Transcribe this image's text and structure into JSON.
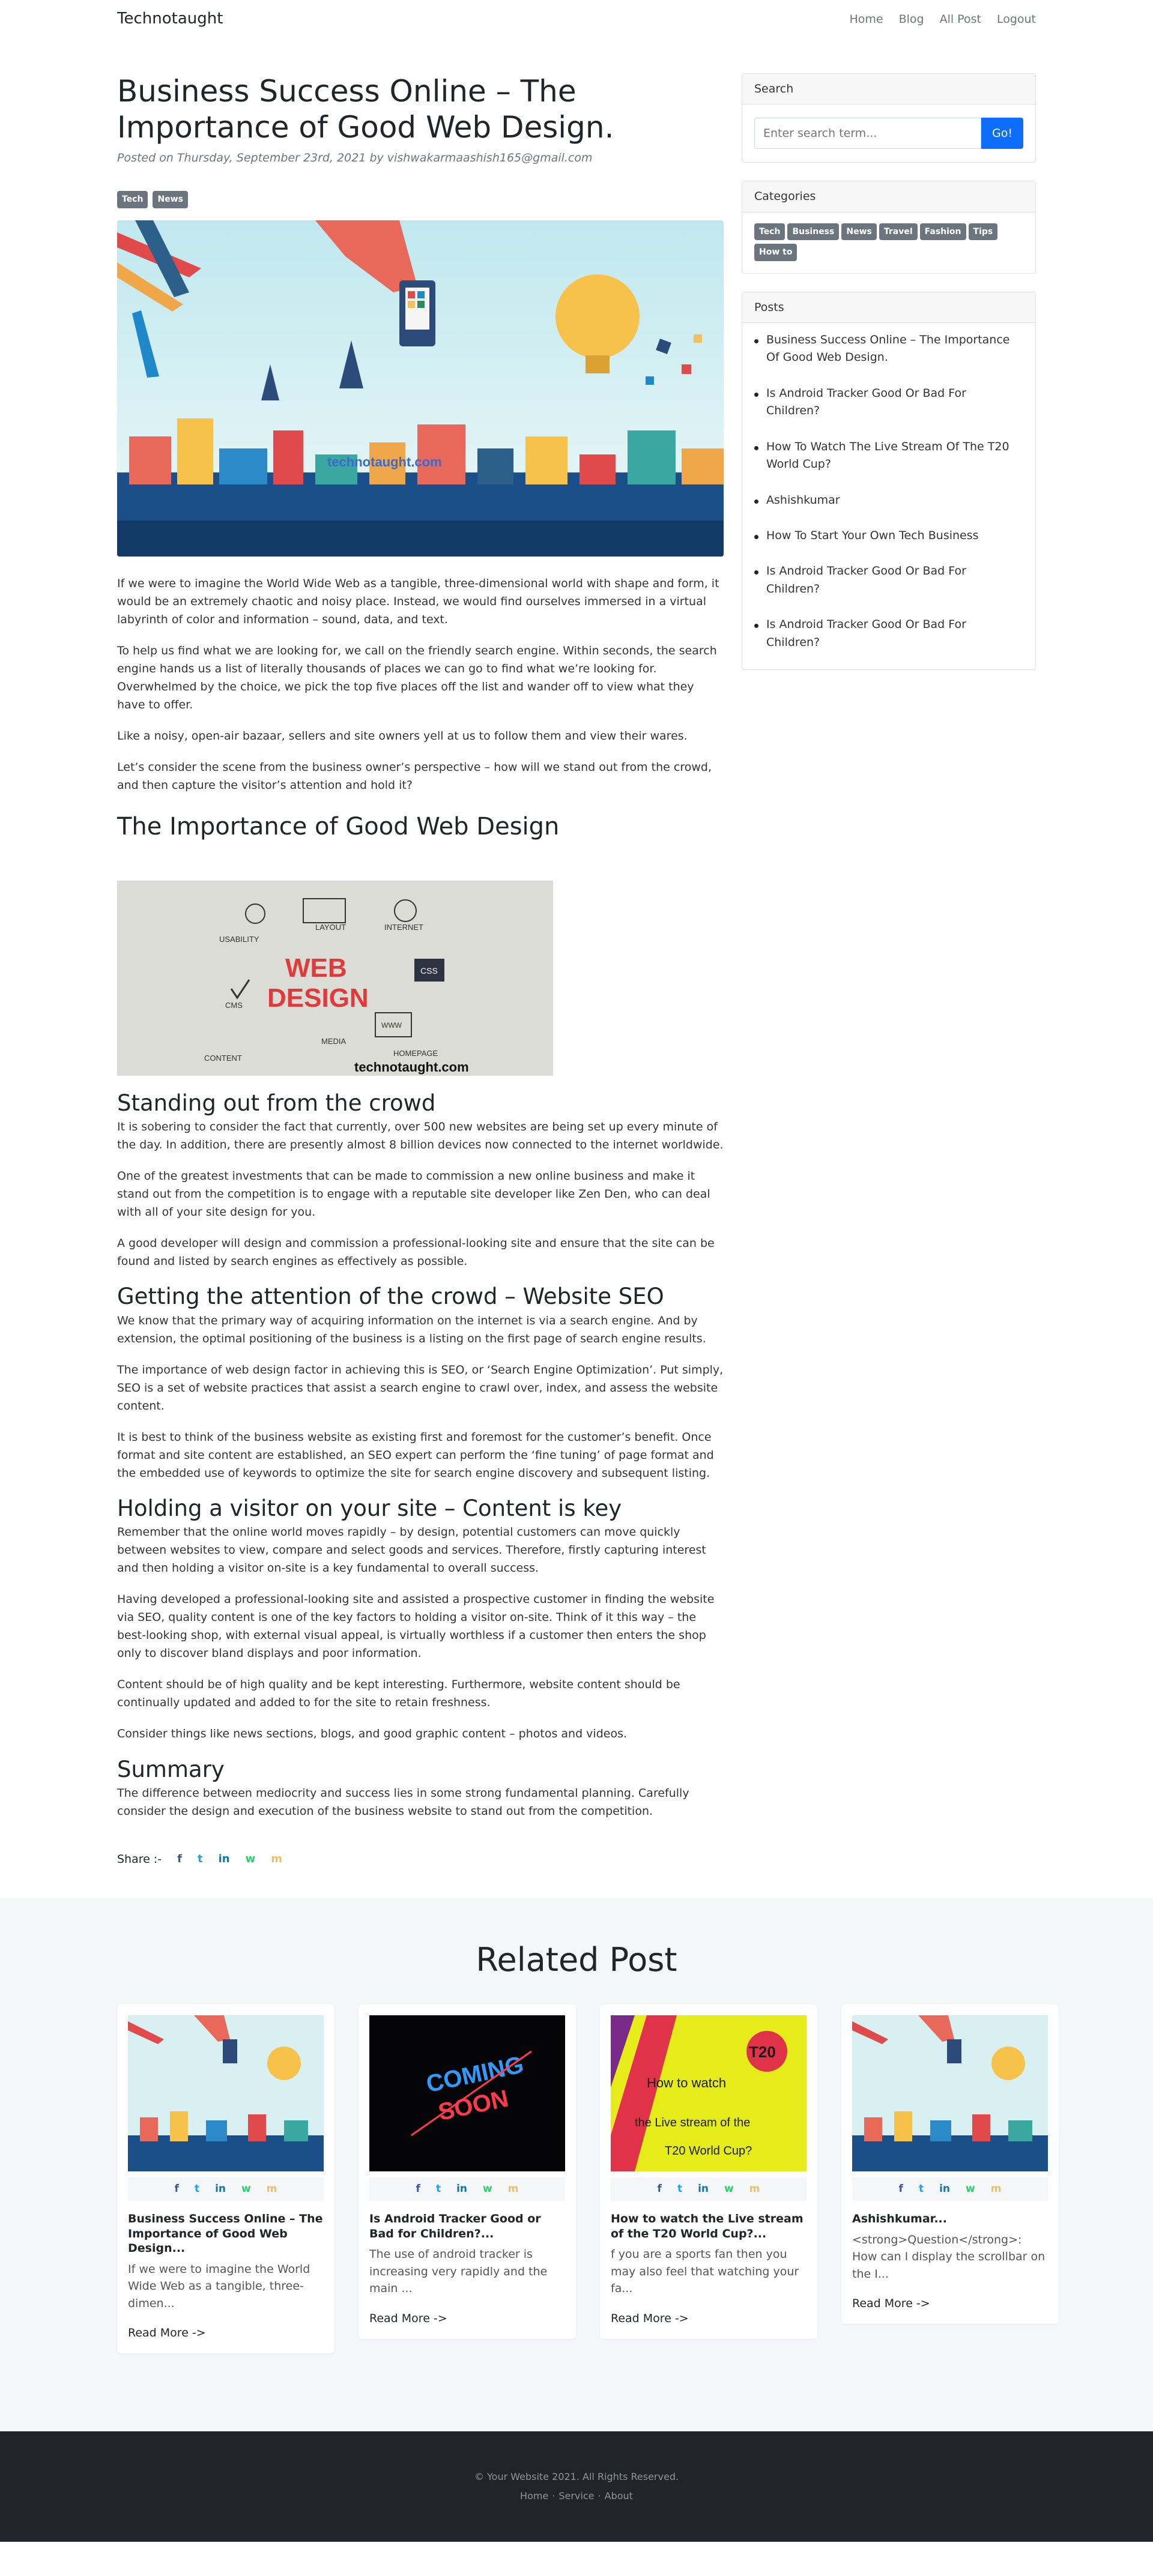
{
  "nav": {
    "brand": "Technotaught",
    "links": [
      "Home",
      "Blog",
      "All Post",
      "Logout"
    ]
  },
  "post": {
    "title": "Business Success Online – The Importance of Good Web Design.",
    "meta": "Posted on Thursday, September 23rd, 2021 by vishwakarmaashish165@gmail.com",
    "tags": [
      "Tech",
      "News"
    ],
    "hero_watermark": "technotaught.com",
    "paragraphs_intro": [
      "If we were to imagine the World Wide Web as a tangible, three-dimensional world with shape and form, it would be an extremely chaotic and noisy place. Instead, we would find ourselves immersed in a virtual labyrinth of color and information – sound, data, and text.",
      "To help us find what we are looking for, we call on the friendly search engine. Within seconds, the search engine hands us a list of literally thousands of places we can go to find what we’re looking for. Overwhelmed by the choice, we pick the top five places off the list and wander off to view what they have to offer.",
      "Like a noisy, open-air bazaar, sellers and site owners yell at us to follow them and view their wares.",
      "Let’s consider the scene from the business owner’s perspective – how will we stand out from the crowd, and then capture the visitor’s attention and hold it?"
    ],
    "h2": "The Importance of Good Web Design",
    "webdesign_image": {
      "words": [
        "USABILITY",
        "LAYOUT",
        "INTERNET",
        "CMS",
        "CSS",
        "CONTENT",
        "MEDIA",
        "HOMEPAGE",
        "WWW"
      ],
      "headline_1": "WEB",
      "headline_2": "DESIGN",
      "watermark": "technotaught.com"
    },
    "sections": [
      {
        "heading": "Standing out from the crowd",
        "paragraphs": [
          "It is sobering to consider the fact that currently, over 500 new websites are being set up every minute of the day. In addition, there are presently almost 8 billion devices now connected to the internet worldwide.",
          "One of the greatest investments that can be made to commission a new online business and make it stand out from the competition is to engage with a reputable site developer like Zen Den, who can deal with all of your site design for you.",
          "A good developer will design and commission a professional-looking site and ensure that the site can be found and listed by search engines as effectively as possible."
        ]
      },
      {
        "heading": "Getting the attention of the crowd – Website SEO",
        "paragraphs": [
          "We know that the primary way of acquiring information on the internet is via a search engine. And by extension, the optimal positioning of the business is a listing on the first page of search engine results.",
          "The importance of web design factor in achieving this is SEO, or ‘Search Engine Optimization’. Put simply, SEO is a set of website practices that assist a search engine to crawl over, index, and assess the website content.",
          "It is best to think of the business website as existing first and foremost for the customer’s benefit. Once format and site content are established, an SEO expert can perform the ‘fine tuning’ of page format and the embedded use of keywords to optimize the site for search engine discovery and subsequent listing."
        ]
      },
      {
        "heading": "Holding a visitor on your site – Content is key",
        "paragraphs": [
          "Remember that the online world moves rapidly – by design, potential customers can move quickly between websites to view, compare and select goods and services. Therefore, firstly capturing interest and then holding a visitor on-site is a key fundamental to overall success.",
          "Having developed a professional-looking site and assisted a prospective customer in finding the website via SEO, quality content is one of the key factors to holding a visitor on-site. Think of it this way – the best-looking shop, with external visual appeal, is virtually worthless if a customer then enters the shop only to discover bland displays and poor information.",
          "Content should be of high quality and be kept interesting. Furthermore, website content should be continually updated and added to for the site to retain freshness.",
          "Consider things like news sections, blogs, and good graphic content – photos and videos."
        ]
      },
      {
        "heading": "Summary",
        "paragraphs": [
          "The difference between mediocrity and success lies in some strong fundamental planning. Carefully consider the design and execution of the business website to stand out from the competition."
        ]
      }
    ],
    "share_label": "Share :-",
    "share_icons": [
      "f",
      "t",
      "in",
      "w",
      "m"
    ]
  },
  "sidebar": {
    "search": {
      "title": "Search",
      "placeholder": "Enter search term...",
      "button": "Go!"
    },
    "categories": {
      "title": "Categories",
      "items": [
        "Tech",
        "Business",
        "News",
        "Travel",
        "Fashion",
        "Tips",
        "How to"
      ]
    },
    "posts": {
      "title": "Posts",
      "items": [
        "Business Success Online – The Importance Of Good Web Design.",
        "Is Android Tracker Good Or Bad For Children?",
        "How To Watch The Live Stream Of The T20 World Cup?",
        "Ashishkumar",
        "How To Start Your Own Tech Business",
        "Is Android Tracker Good Or Bad For Children?",
        "Is Android Tracker Good Or Bad For Children?"
      ]
    }
  },
  "related": {
    "title": "Related Post",
    "read_more": "Read More ->",
    "cards": [
      {
        "title": "Business Success Online – The Importance of Good Web Design...",
        "excerpt": "If we were to imagine the World Wide Web as a tangible, three-dimen..."
      },
      {
        "title": "Is Android Tracker Good or Bad for Children?...",
        "excerpt": "The use of android tracker is increasing very rapidly and the main ...",
        "image_text_1": "COMING",
        "image_text_2": "SOON"
      },
      {
        "title": "How to watch the Live stream of the T20 World Cup?...",
        "excerpt": "f you are a sports fan then you may also feel that watching your fa...",
        "image_text_1": "How to watch",
        "image_text_2": "the Live stream of the",
        "image_text_3": "T20 World Cup?",
        "image_badge": "T20"
      },
      {
        "title": "Ashishkumar...",
        "excerpt": "<strong>Question</strong>: How can I display the scrollbar on the I..."
      }
    ]
  },
  "footer": {
    "copyright": "© Your Website 2021. All Rights Reserved.",
    "links": [
      "Home",
      "·",
      "Service",
      "·",
      "About"
    ]
  },
  "colors": {
    "primary": "#0d6efd",
    "badge": "#6c757d",
    "footer_bg": "#212529",
    "facebook": "#3b5998",
    "twitter": "#1da1f2",
    "linkedin": "#0e76a8",
    "whatsapp": "#25d366",
    "mail": "#f0c05a"
  }
}
